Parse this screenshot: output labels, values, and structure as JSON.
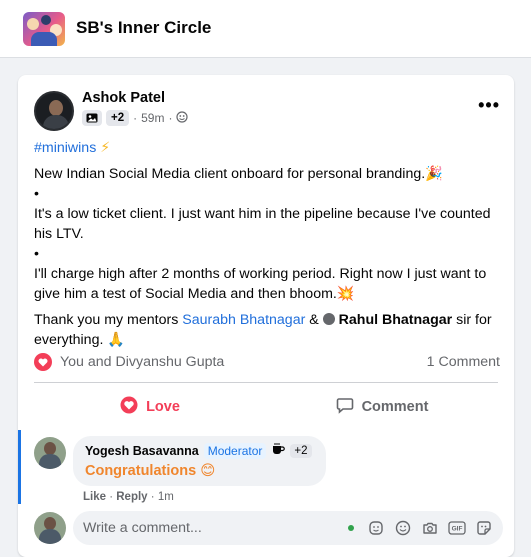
{
  "group": {
    "title": "SB's Inner Circle"
  },
  "post": {
    "author": "Ashok Patel",
    "badge_extra": "+2",
    "time": "59m",
    "hashtag": "#miniwins",
    "line1": "New Indian Social Media client onboard for personal branding.",
    "bullet": "•",
    "line2": "It's a low ticket client. I just want him in the pipeline because I've counted his LTV.",
    "line3": "I'll charge high after 2 months of working period. Right now I just want to give him a test of Social Media and then bhoom.",
    "thanks_prefix": "Thank you my mentors",
    "mentor1": "Saurabh Bhatnagar",
    "amp": "&",
    "mentor2": "Rahul Bhatnagar",
    "thanks_suffix": "sir for everything."
  },
  "reactions": {
    "who": "You and Divyanshu Gupta",
    "comment_count": "1 Comment"
  },
  "actions": {
    "love": "Love",
    "comment": "Comment"
  },
  "comment": {
    "name": "Yogesh Basavanna",
    "role": "Moderator",
    "extra": "+2",
    "text": "Congratulations",
    "like": "Like",
    "reply": "Reply",
    "time": "1m"
  },
  "composer": {
    "placeholder": "Write a comment..."
  },
  "colors": {
    "accent": "#1b74e4",
    "love": "#f33e58",
    "congrats": "#f0862d"
  },
  "icons": [
    "more-icon",
    "globe-icon",
    "heart-icon",
    "comment-icon",
    "emoji-icon",
    "camera-icon",
    "gif-icon",
    "sticker-icon"
  ]
}
